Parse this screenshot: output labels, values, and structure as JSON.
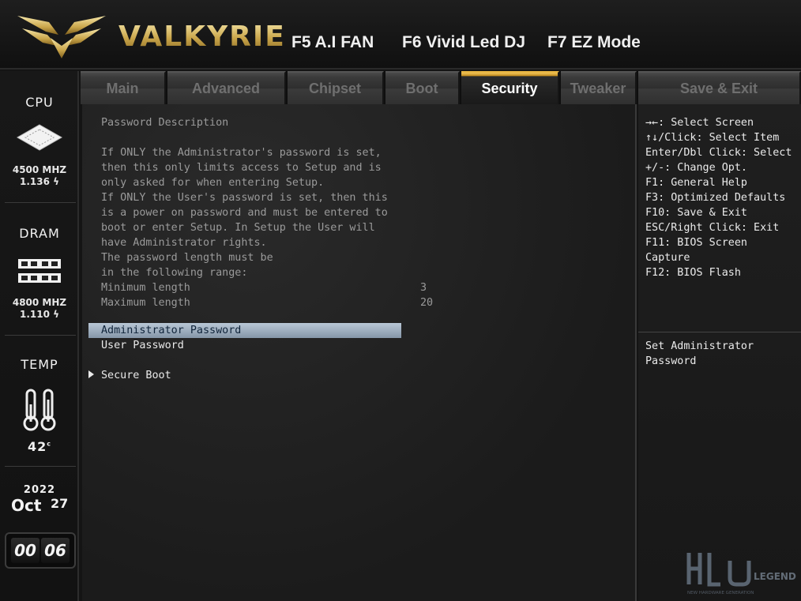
{
  "header": {
    "brand": "VALKYRIE",
    "hotkeys": [
      "F5 A.I FAN",
      "F6 Vivid Led DJ",
      "F7 EZ Mode"
    ]
  },
  "sidebar": {
    "cpu": {
      "label": "CPU",
      "freq": "4500 MHZ",
      "volt": "1.136"
    },
    "dram": {
      "label": "DRAM",
      "freq": "4800 MHZ",
      "volt": "1.110"
    },
    "temp": {
      "label": "TEMP",
      "value": "42",
      "unit": "c"
    },
    "date": {
      "year": "2022",
      "month": "Oct",
      "day": "27"
    },
    "clock": {
      "hours": "00",
      "minutes": "06"
    }
  },
  "tabs": [
    "Main",
    "Advanced",
    "Chipset",
    "Boot",
    "Security",
    "Tweaker",
    "Save & Exit"
  ],
  "active_tab": "Security",
  "main": {
    "title": "Password Description",
    "desc": [
      "If ONLY the Administrator's password is set,",
      "then this only limits access to Setup and is",
      "only asked for when entering Setup.",
      "If ONLY the User's password is set, then this",
      "is a power on password and must be entered to",
      "boot or enter Setup. In Setup the User will",
      "have Administrator rights.",
      "The password length must be",
      "in the following range:"
    ],
    "min_label": "Minimum length",
    "min_value": "3",
    "max_label": "Maximum length",
    "max_value": "20",
    "admin_password": "Administrator Password",
    "user_password": "User Password",
    "secure_boot": "Secure Boot"
  },
  "help": {
    "keys": [
      "→←: Select Screen",
      "↑↓/Click: Select Item",
      "Enter/Dbl Click: Select",
      "+/-: Change Opt.",
      "F1: General Help",
      "F3: Optimized Defaults",
      "F10: Save & Exit",
      "ESC/Right Click: Exit",
      "F11: BIOS Screen",
      "Capture",
      "F12: BIOS Flash"
    ],
    "item_help": [
      "Set Administrator",
      "Password"
    ]
  },
  "watermark": {
    "line1": "LEGEND",
    "line2": "NEW HARDWARE GENERATION"
  },
  "colors": {
    "accent_gold": "#e8b540",
    "highlight": "#a8b8c9",
    "bg": "#1b1b1b"
  }
}
